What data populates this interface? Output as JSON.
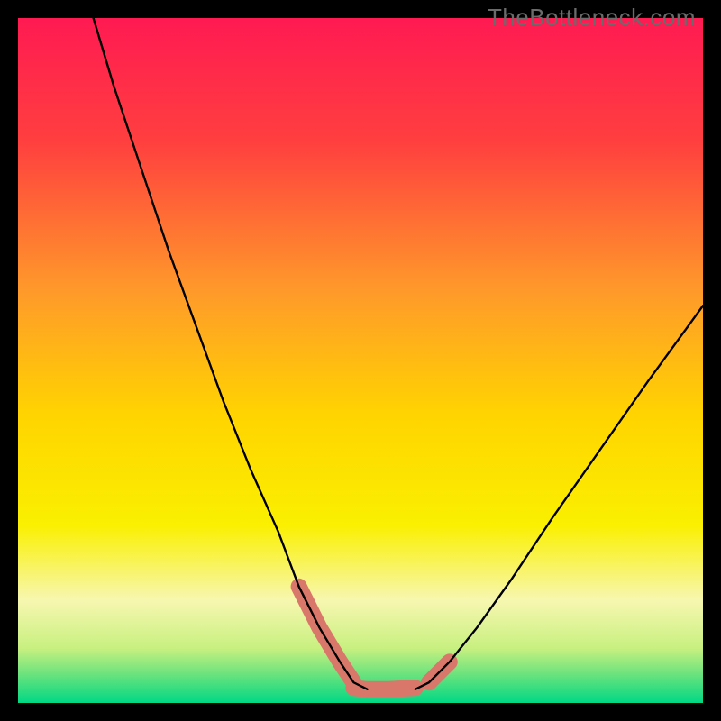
{
  "watermark": "TheBottleneck.com",
  "chart_data": {
    "type": "line",
    "title": "",
    "xlabel": "",
    "ylabel": "",
    "xlim": [
      0,
      100
    ],
    "ylim": [
      0,
      100
    ],
    "grid": false,
    "legend": false,
    "series": [
      {
        "name": "left-curve",
        "x": [
          11,
          14,
          18,
          22,
          26,
          30,
          34,
          38,
          41,
          44,
          47,
          49,
          51
        ],
        "values": [
          100,
          90,
          78,
          66,
          55,
          44,
          34,
          25,
          17,
          11,
          6,
          3,
          2
        ]
      },
      {
        "name": "right-curve",
        "x": [
          58,
          60,
          63,
          67,
          72,
          78,
          85,
          92,
          100
        ],
        "values": [
          2,
          3,
          6,
          11,
          18,
          27,
          37,
          47,
          58
        ]
      },
      {
        "name": "emphasis-segments",
        "note": "salmon thick segments near valley bottom",
        "segments": [
          {
            "x": [
              41,
              44,
              47
            ],
            "values": [
              17,
              11,
              6
            ]
          },
          {
            "x": [
              47,
              49
            ],
            "values": [
              6,
              3
            ]
          },
          {
            "x": [
              49,
              51,
              54,
              58
            ],
            "values": [
              2.2,
              2,
              2,
              2.2
            ]
          },
          {
            "x": [
              60,
              63
            ],
            "values": [
              3,
              6
            ]
          }
        ]
      }
    ],
    "background_gradient": {
      "stops": [
        {
          "offset": 0.0,
          "color": "#ff1a52"
        },
        {
          "offset": 0.18,
          "color": "#ff3f3f"
        },
        {
          "offset": 0.4,
          "color": "#ff9a2a"
        },
        {
          "offset": 0.58,
          "color": "#ffd400"
        },
        {
          "offset": 0.74,
          "color": "#faf000"
        },
        {
          "offset": 0.85,
          "color": "#f7f7b0"
        },
        {
          "offset": 0.92,
          "color": "#c8f080"
        },
        {
          "offset": 0.96,
          "color": "#66e27d"
        },
        {
          "offset": 1.0,
          "color": "#00d884"
        }
      ]
    },
    "colors": {
      "curve": "#000000",
      "emphasis": "#d9776a",
      "frame": "#000000"
    }
  }
}
